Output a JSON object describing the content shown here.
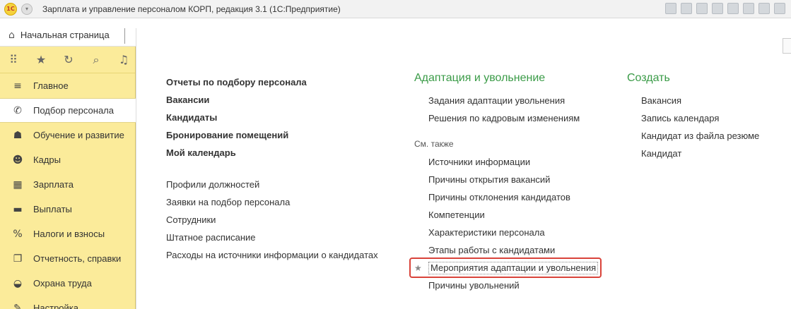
{
  "window": {
    "logo_text": "1С",
    "title": "Зарплата и управление персоналом КОРП, редакция 3.1  (1С:Предприятие)"
  },
  "tabs": {
    "home_label": "Начальная страница",
    "home_icon": "home-icon"
  },
  "sidebar": {
    "top_icons": [
      "grid-icon",
      "star-icon",
      "history-icon",
      "search-icon",
      "bell-icon"
    ],
    "items": [
      {
        "label": "Главное",
        "icon": "menu-lines-icon",
        "active": false
      },
      {
        "label": "Подбор персонала",
        "icon": "phone-icon",
        "active": true
      },
      {
        "label": "Обучение и развитие",
        "icon": "training-icon",
        "active": false
      },
      {
        "label": "Кадры",
        "icon": "people-icon",
        "active": false
      },
      {
        "label": "Зарплата",
        "icon": "calculator-icon",
        "active": false
      },
      {
        "label": "Выплаты",
        "icon": "cash-icon",
        "active": false
      },
      {
        "label": "Налоги и взносы",
        "icon": "percent-icon",
        "active": false
      },
      {
        "label": "Отчетность, справки",
        "icon": "reports-icon",
        "active": false
      },
      {
        "label": "Охрана труда",
        "icon": "helmet-icon",
        "active": false
      },
      {
        "label": "Настройка",
        "icon": "wrench-icon",
        "active": false
      }
    ]
  },
  "main": {
    "col1": {
      "bold_links": [
        "Отчеты по подбору персонала",
        "Вакансии",
        "Кандидаты",
        "Бронирование помещений",
        "Мой календарь"
      ],
      "links": [
        "Профили должностей",
        "Заявки на подбор персонала",
        "Сотрудники",
        "Штатное расписание",
        "Расходы на источники информации о кандидатах"
      ]
    },
    "col2": {
      "title": "Адаптация и увольнение",
      "links": [
        "Задания адаптации увольнения",
        "Решения по кадровым изменениям"
      ],
      "see_also": "См. также",
      "see_also_links": [
        "Источники информации",
        "Причины открытия вакансий",
        "Причины отклонения кандидатов",
        "Компетенции",
        "Характеристики персонала",
        "Этапы работы с кандидатами"
      ],
      "highlighted_link": "Мероприятия адаптации и увольнения",
      "last_link": "Причины увольнений"
    },
    "col3": {
      "title": "Создать",
      "links": [
        "Вакансия",
        "Запись календаря",
        "Кандидат из файла резюме",
        "Кандидат"
      ]
    }
  },
  "colors": {
    "sidebar_bg": "#fbeb9a",
    "section_title": "#3a9b47",
    "highlight_border": "#d9433a"
  }
}
